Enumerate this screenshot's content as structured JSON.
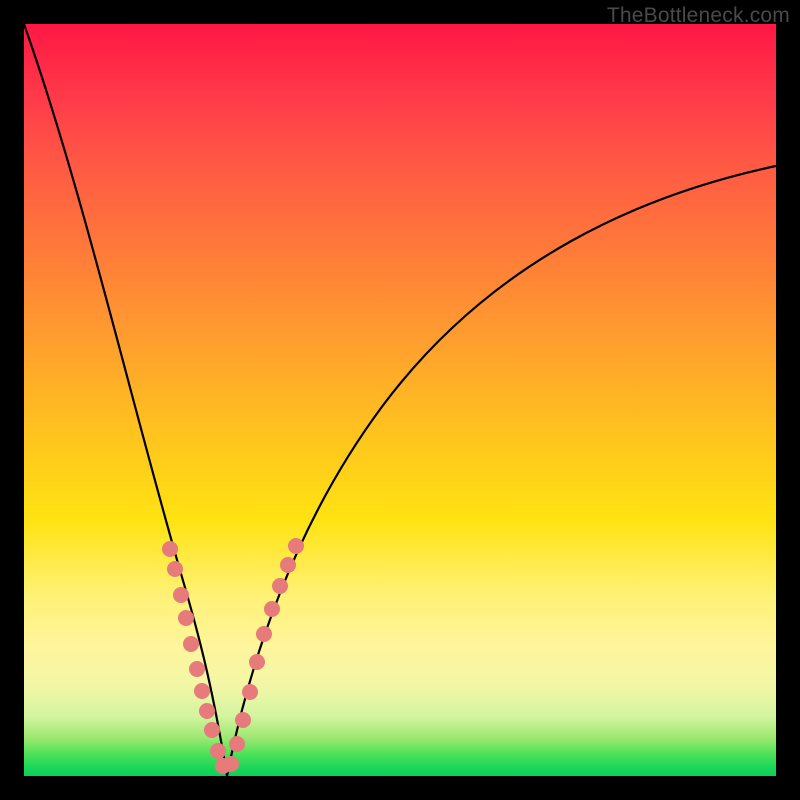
{
  "watermark": {
    "text": "TheBottleneck.com"
  },
  "chart_data": {
    "type": "line",
    "title": "",
    "xlabel": "",
    "ylabel": "",
    "xlim": [
      0,
      100
    ],
    "ylim": [
      0,
      100
    ],
    "background_gradient": {
      "direction": "vertical",
      "stops": [
        {
          "pos": 0,
          "color": "#ff1744"
        },
        {
          "pos": 30,
          "color": "#ff7a3a"
        },
        {
          "pos": 66,
          "color": "#ffe312"
        },
        {
          "pos": 92,
          "color": "#d4f5a0"
        },
        {
          "pos": 100,
          "color": "#0bd156"
        }
      ]
    },
    "series": [
      {
        "name": "left-branch-curve",
        "color": "#000000",
        "x": [
          0,
          2,
          4,
          6,
          8,
          10,
          12,
          14,
          16,
          18,
          20,
          21,
          22,
          23,
          24,
          25,
          26,
          27
        ],
        "y": [
          100,
          90,
          82,
          75,
          68,
          62,
          55,
          49,
          42,
          35,
          27,
          23,
          19,
          15,
          11,
          7,
          3,
          0
        ]
      },
      {
        "name": "right-branch-curve",
        "color": "#000000",
        "x": [
          27,
          28,
          30,
          32,
          35,
          38,
          42,
          46,
          50,
          55,
          60,
          65,
          70,
          75,
          80,
          85,
          90,
          95,
          100
        ],
        "y": [
          0,
          5,
          12,
          19,
          27,
          34,
          42,
          48,
          53,
          58,
          62,
          66,
          69,
          72,
          74,
          76,
          78,
          80,
          81
        ]
      },
      {
        "name": "left-branch-dots",
        "color": "#e77a7a",
        "type": "scatter",
        "x": [
          19.3,
          20.0,
          20.8,
          21.5,
          22.3,
          23.0,
          23.8,
          24.5,
          25.2,
          26.0,
          26.5
        ],
        "y": [
          30,
          27,
          23.5,
          20.5,
          17,
          14,
          11,
          8.5,
          6,
          3,
          1.5
        ]
      },
      {
        "name": "right-branch-dots",
        "color": "#e77a7a",
        "type": "scatter",
        "x": [
          27.5,
          28.3,
          29.1,
          30.0,
          31.0,
          32.0,
          33.0,
          34.0,
          35.0,
          36.0
        ],
        "y": [
          1.5,
          4,
          7,
          11,
          15,
          19,
          22,
          25,
          28,
          30
        ]
      }
    ]
  }
}
